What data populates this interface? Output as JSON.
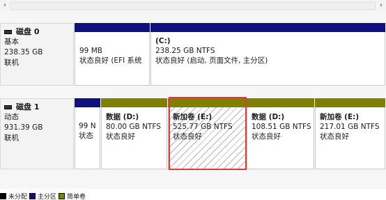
{
  "disks": [
    {
      "title": "磁盘 0",
      "type": "基本",
      "size": "238.35 GB",
      "status": "联机",
      "partitions": [
        {
          "name": "",
          "size": "99 MB",
          "status": "状态良好 (EFI 系统",
          "bar_color": "#10107f"
        },
        {
          "name": "(C:)",
          "size": "238.25 GB NTFS",
          "status": "状态良好 (启动, 页面文件, 主分区)",
          "bar_color": "#10107f"
        }
      ]
    },
    {
      "title": "磁盘 1",
      "type": "动态",
      "size": "931.39 GB",
      "status": "联机",
      "partitions": [
        {
          "name": "",
          "size": "99 N",
          "status": "状态",
          "bar_color": "#10107f"
        },
        {
          "name": "数据  (D:)",
          "size": "80.00 GB NTFS",
          "status": "状态良好",
          "bar_color": "#808000"
        },
        {
          "name": "新加卷  (E:)",
          "size": "525.77 GB NTFS",
          "status": "状态良好",
          "bar_color": "#808000",
          "selected": true
        },
        {
          "name": "数据  (D:)",
          "size": "108.51 GB NTFS",
          "status": "状态良好",
          "bar_color": "#808000"
        },
        {
          "name": "新加卷  (E:)",
          "size": "217.01 GB NTFS",
          "status": "状态良好",
          "bar_color": "#808000"
        }
      ]
    }
  ],
  "legend": [
    {
      "label": "未分配",
      "color": "#000000"
    },
    {
      "label": "主分区",
      "color": "#10107f"
    },
    {
      "label": "简单卷",
      "color": "#808000"
    }
  ],
  "icons": {
    "scroll_left": "chevron-left-icon",
    "scroll_right": "chevron-right-icon",
    "disk": "disk-icon"
  }
}
